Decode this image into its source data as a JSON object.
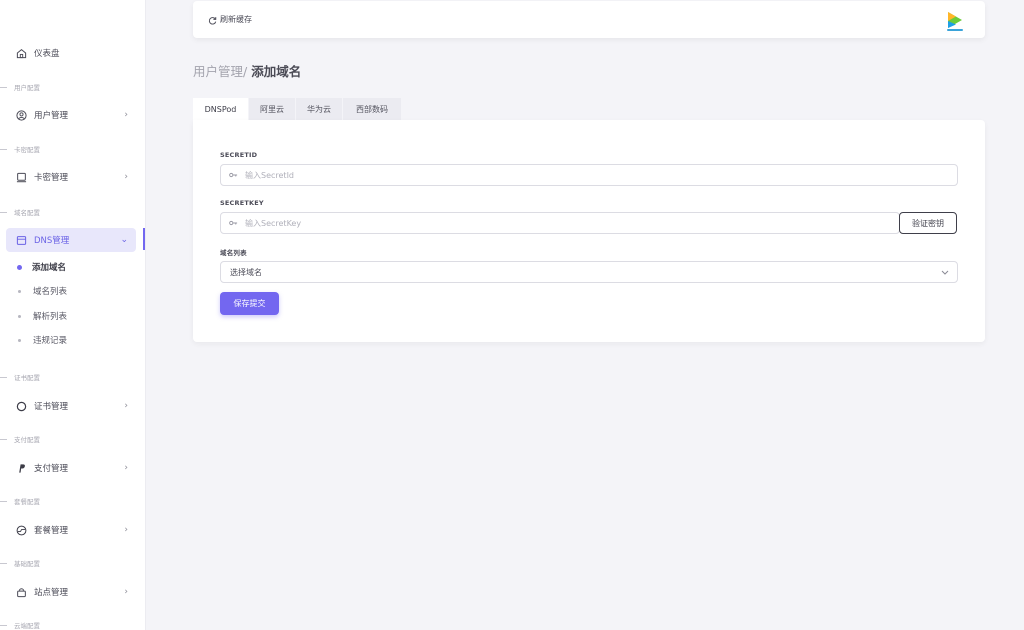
{
  "sidebar": {
    "dashboard": "仪表盘",
    "sections": [
      {
        "title": "用户配置",
        "item": "用户管理"
      },
      {
        "title": "卡密配置",
        "item": "卡密管理"
      },
      {
        "title": "域名配置",
        "item": "DNS管理"
      },
      {
        "title": "证书配置",
        "item": "证书管理"
      },
      {
        "title": "支付配置",
        "item": "支付管理"
      },
      {
        "title": "套餐配置",
        "item": "套餐管理"
      },
      {
        "title": "基础配置",
        "item": "站点管理"
      },
      {
        "title": "云端配置"
      }
    ],
    "dns_sub": [
      "添加域名",
      "域名列表",
      "解析列表",
      "违规记录"
    ]
  },
  "topbar": {
    "refresh_label": "刷新缓存"
  },
  "breadcrumb": {
    "parent": "用户管理/ ",
    "current": "添加域名"
  },
  "tabs": [
    "DNSPod",
    "阿里云",
    "华为云",
    "西部数码"
  ],
  "form": {
    "secretid_label": "SECRETID",
    "secretid_placeholder": "输入SecretId",
    "secretkey_label": "SECRETKEY",
    "secretkey_placeholder": "输入SecretKey",
    "verify_label": "验证密钥",
    "domain_list_label": "域名列表",
    "domain_select_value": "选择域名",
    "submit_label": "保存提交"
  },
  "colors": {
    "accent": "#7367f0",
    "background": "#f4f4f8"
  },
  "icons": [
    "home-icon",
    "user-circle-icon",
    "card-icon",
    "dns-icon",
    "certificate-icon",
    "paypal-icon",
    "package-icon",
    "bag-icon",
    "refresh-icon",
    "key-icon",
    "chevron-right-icon",
    "chevron-down-icon"
  ]
}
